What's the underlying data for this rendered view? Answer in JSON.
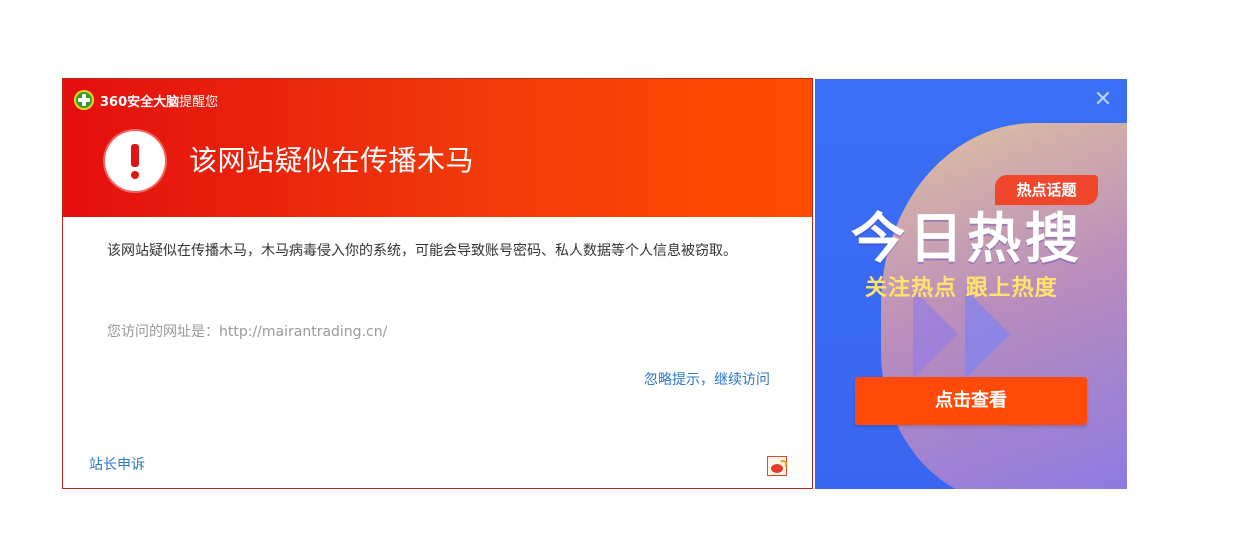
{
  "dialog": {
    "brand_name": "360安全大脑",
    "brand_suffix": "提醒您",
    "headline": "该网站疑似在传播木马",
    "description": "该网站疑似在传播木马，木马病毒侵入你的系统，可能会导致账号密码、私人数据等个人信息被窃取。",
    "url_line": "您访问的网址是：http://mairantrading.cn/",
    "ignore_link": "忽略提示，继续访问",
    "complain_link": "站长申诉",
    "colors": {
      "header_start": "#e40e0e",
      "header_end": "#ff4e00",
      "link": "#2b78c8"
    }
  },
  "ad": {
    "tag": "热点话题",
    "title": "今日热搜",
    "subtitle": "关注热点  跟上热度",
    "button": "点击查看",
    "close_icon": "close-icon",
    "colors": {
      "background": "#3a6ff5",
      "button": "#ff4a0a",
      "subtitle": "#ffe36a"
    }
  }
}
